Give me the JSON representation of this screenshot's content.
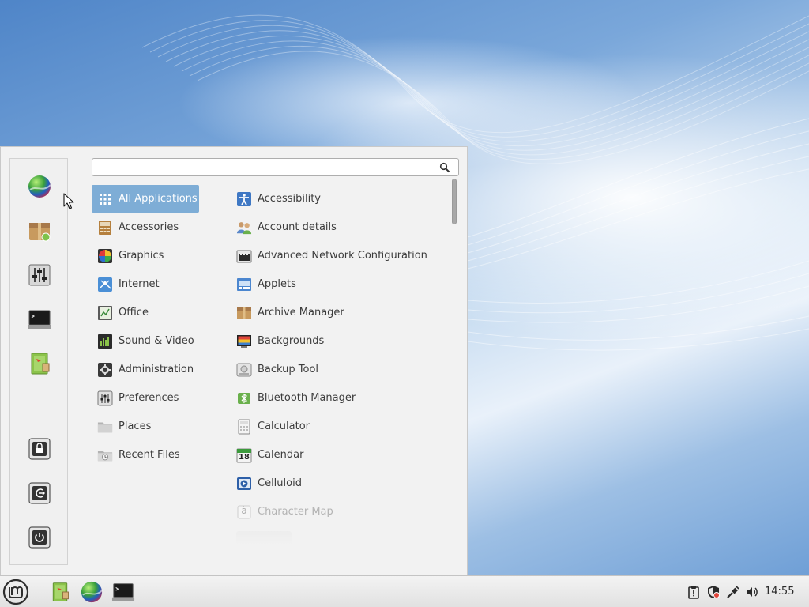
{
  "search": {
    "value": "",
    "placeholder": ""
  },
  "favorites": [
    {
      "icon": "web-browser-icon",
      "name": "Web Browser"
    },
    {
      "icon": "software-manager-icon",
      "name": "Software Manager"
    },
    {
      "icon": "system-settings-icon",
      "name": "System Settings"
    },
    {
      "icon": "terminal-icon",
      "name": "Terminal"
    },
    {
      "icon": "files-icon",
      "name": "Files"
    }
  ],
  "session": [
    {
      "icon": "lock-icon",
      "name": "Lock Screen"
    },
    {
      "icon": "logout-icon",
      "name": "Logout"
    },
    {
      "icon": "power-icon",
      "name": "Quit"
    }
  ],
  "categories": [
    {
      "label": "All Applications",
      "icon": "grid-icon",
      "selected": true
    },
    {
      "label": "Accessories",
      "icon": "accessories-icon"
    },
    {
      "label": "Graphics",
      "icon": "graphics-icon"
    },
    {
      "label": "Internet",
      "icon": "internet-icon"
    },
    {
      "label": "Office",
      "icon": "office-icon"
    },
    {
      "label": "Sound & Video",
      "icon": "sound-video-icon"
    },
    {
      "label": "Administration",
      "icon": "administration-icon"
    },
    {
      "label": "Preferences",
      "icon": "preferences-icon"
    },
    {
      "label": "Places",
      "icon": "folder-icon"
    },
    {
      "label": "Recent Files",
      "icon": "recent-files-icon"
    }
  ],
  "apps": [
    {
      "label": "Accessibility",
      "icon": "accessibility-icon"
    },
    {
      "label": "Account details",
      "icon": "account-details-icon"
    },
    {
      "label": "Advanced Network Configuration",
      "icon": "network-config-icon"
    },
    {
      "label": "Applets",
      "icon": "applets-icon"
    },
    {
      "label": "Archive Manager",
      "icon": "archive-manager-icon"
    },
    {
      "label": "Backgrounds",
      "icon": "backgrounds-icon"
    },
    {
      "label": "Backup Tool",
      "icon": "backup-tool-icon"
    },
    {
      "label": "Bluetooth Manager",
      "icon": "bluetooth-manager-icon"
    },
    {
      "label": "Calculator",
      "icon": "calculator-icon"
    },
    {
      "label": "Calendar",
      "icon": "calendar-icon",
      "badge": "18"
    },
    {
      "label": "Celluloid",
      "icon": "celluloid-icon"
    },
    {
      "label": "Character Map",
      "icon": "character-map-icon",
      "badge": "à",
      "dim": true
    }
  ],
  "panel": {
    "launchers": [
      {
        "icon": "files-icon",
        "name": "Files"
      },
      {
        "icon": "web-browser-icon",
        "name": "Web Browser"
      },
      {
        "icon": "terminal-icon",
        "name": "Terminal"
      }
    ],
    "tray": [
      "clipboard-icon",
      "update-shield-icon",
      "network-icon",
      "volume-icon"
    ],
    "clock": "14:55"
  },
  "colors": {
    "selection": "#7eadd6",
    "menu_bg": "#f2f2f2",
    "panel_bg": "#e8e8e8",
    "mint_green": "#8bc34a"
  }
}
